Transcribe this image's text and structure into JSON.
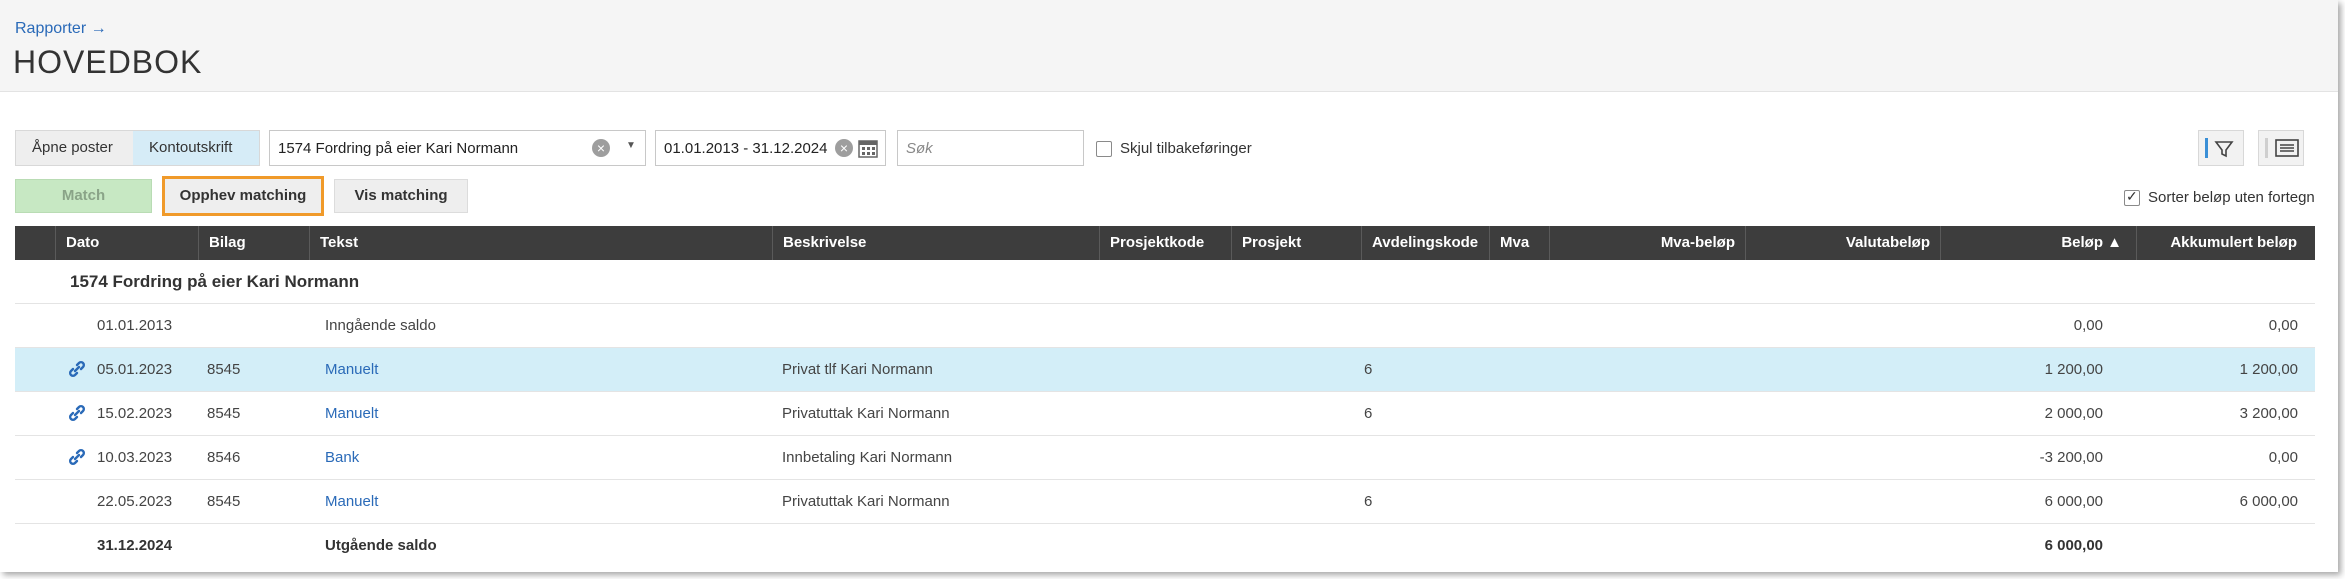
{
  "header": {
    "breadcrumb": "Rapporter →",
    "title": "HOVEDBOK"
  },
  "toolbar": {
    "tabs": [
      {
        "label": "Åpne poster",
        "active": false
      },
      {
        "label": "Kontoutskrift",
        "active": true
      }
    ],
    "account_value": "1574 Fordring på eier Kari Normann",
    "date_range_value": "01.01.2013 - 31.12.2024",
    "search_placeholder": "Søk",
    "hide_reversals_label": "Skjul tilbakeføringer",
    "hide_reversals_checked": false,
    "filter_icon": "filter-icon",
    "comment_icon": "comment-icon"
  },
  "actions": {
    "match_label": "Match",
    "unmatch_label": "Opphev matching",
    "show_matching_label": "Vis matching",
    "sort_abs_label": "Sorter beløp uten fortegn",
    "sort_abs_checked": true
  },
  "grid": {
    "columns": {
      "dato": "Dato",
      "bilag": "Bilag",
      "tekst": "Tekst",
      "beskrivelse": "Beskrivelse",
      "prosjektkode": "Prosjektkode",
      "prosjekt": "Prosjekt",
      "avdelingskode": "Avdelingskode",
      "mva": "Mva",
      "mva_belop": "Mva-beløp",
      "valutabelop": "Valutabeløp",
      "belop": "Beløp ▲",
      "akkumulert": "Akkumulert beløp"
    },
    "group_title": "1574 Fordring på eier Kari Normann",
    "rows": [
      {
        "linked": false,
        "selected": false,
        "dato": "01.01.2013",
        "bilag": "",
        "tekst": "Inngående saldo",
        "tekst_link": false,
        "beskrivelse": "",
        "avdelingskode": "",
        "belop": "0,00",
        "akkumulert": "0,00"
      },
      {
        "linked": true,
        "selected": true,
        "dato": "05.01.2023",
        "bilag": "8545",
        "tekst": "Manuelt",
        "tekst_link": true,
        "beskrivelse": "Privat tlf Kari Normann",
        "avdelingskode": "6",
        "belop": "1 200,00",
        "akkumulert": "1 200,00"
      },
      {
        "linked": true,
        "selected": false,
        "dato": "15.02.2023",
        "bilag": "8545",
        "tekst": "Manuelt",
        "tekst_link": true,
        "beskrivelse": "Privatuttak Kari Normann",
        "avdelingskode": "6",
        "belop": "2 000,00",
        "akkumulert": "3 200,00"
      },
      {
        "linked": true,
        "selected": false,
        "dato": "10.03.2023",
        "bilag": "8546",
        "tekst": "Bank",
        "tekst_link": true,
        "beskrivelse": "Innbetaling Kari Normann",
        "avdelingskode": "",
        "belop": "-3 200,00",
        "akkumulert": "0,00"
      },
      {
        "linked": false,
        "selected": false,
        "dato": "22.05.2023",
        "bilag": "8545",
        "tekst": "Manuelt",
        "tekst_link": true,
        "beskrivelse": "Privatuttak Kari Normann",
        "avdelingskode": "6",
        "belop": "6 000,00",
        "akkumulert": "6 000,00"
      }
    ],
    "total_row": {
      "dato": "31.12.2024",
      "tekst": "Utgående saldo",
      "belop": "6 000,00"
    }
  }
}
